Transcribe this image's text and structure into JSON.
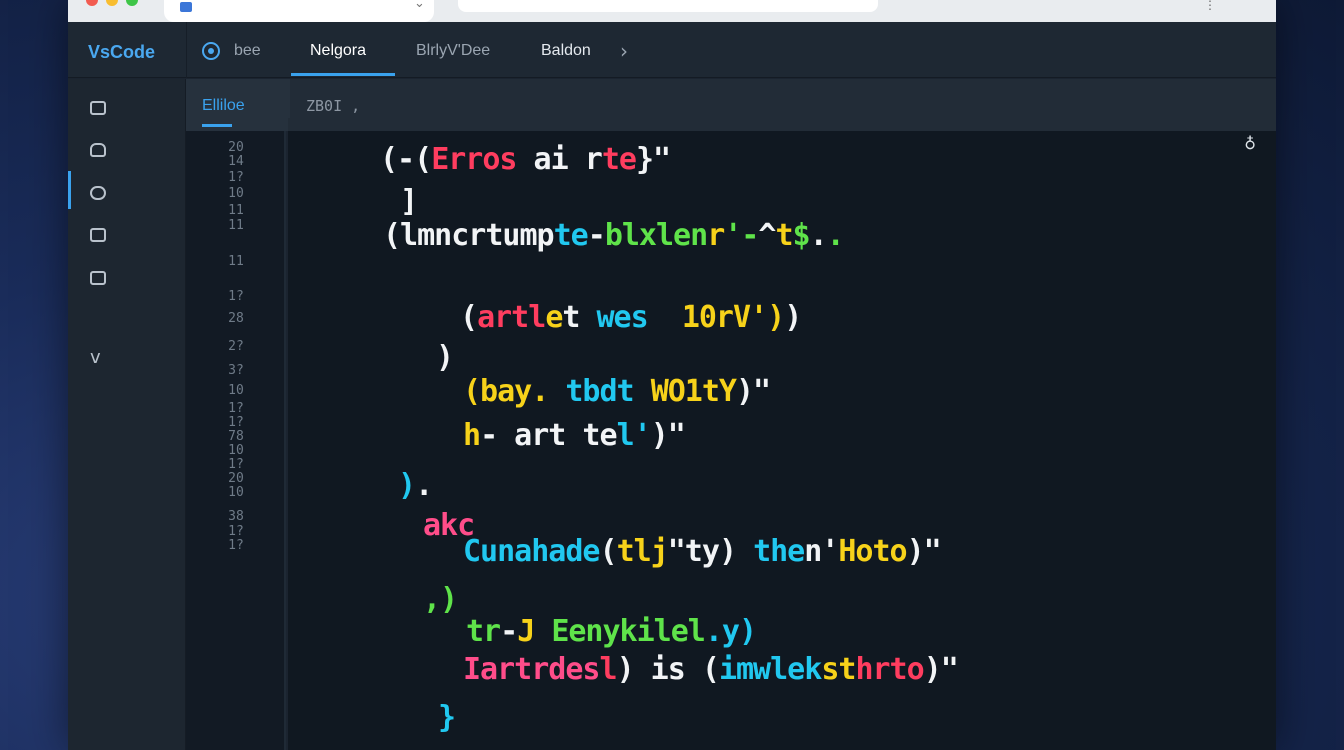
{
  "app": {
    "brand": "VsCode",
    "nav": [
      "bee",
      "Nelgora",
      "BlrlyV'Dee",
      "Baldon"
    ],
    "active_nav": 1
  },
  "editor_tabs": [
    "Elliloe",
    "ZB0I ,"
  ],
  "line_numbers": [
    "20",
    "14",
    "1?",
    "10",
    "11",
    "11",
    "11",
    "1?",
    "28",
    "2?",
    "3?",
    "10",
    "1?",
    "1?",
    "78",
    "10",
    "1?",
    "20",
    "10",
    "38",
    "1?",
    "1?"
  ],
  "code_lines": [
    [
      {
        "t": "(-(",
        "c": "w"
      },
      {
        "t": "Erros",
        "c": "r"
      },
      {
        "t": " ai ",
        "c": "w"
      },
      {
        "t": "r",
        "c": "w"
      },
      {
        "t": "te",
        "c": "r"
      },
      {
        "t": "}\"",
        "c": "w"
      }
    ],
    [
      {
        "t": "]",
        "c": "w"
      }
    ],
    [
      {
        "t": "(lmncrtump",
        "c": "w"
      },
      {
        "t": "te",
        "c": "c"
      },
      {
        "t": "-",
        "c": "w"
      },
      {
        "t": "blxlen",
        "c": "g"
      },
      {
        "t": "r",
        "c": "y"
      },
      {
        "t": "'-",
        "c": "g"
      },
      {
        "t": "^",
        "c": "w"
      },
      {
        "t": "t",
        "c": "y"
      },
      {
        "t": "$",
        "c": "g"
      },
      {
        "t": ".",
        "c": "w"
      },
      {
        "t": ".",
        "c": "g"
      }
    ],
    [
      {
        "t": "(",
        "c": "w"
      },
      {
        "t": "artl",
        "c": "r"
      },
      {
        "t": "e",
        "c": "y"
      },
      {
        "t": "t ",
        "c": "w"
      },
      {
        "t": "wes",
        "c": "c"
      },
      {
        "t": "  ",
        "c": "w"
      },
      {
        "t": "10rV')",
        "c": "y"
      },
      {
        "t": ")",
        "c": "w"
      }
    ],
    [
      {
        "t": ")",
        "c": "w"
      }
    ],
    [
      {
        "t": "(bay.",
        "c": "y"
      },
      {
        "t": " tbdt",
        "c": "c"
      },
      {
        "t": " ",
        "c": "w"
      },
      {
        "t": "WO1tY",
        "c": "y"
      },
      {
        "t": ")\"",
        "c": "w"
      }
    ],
    [
      {
        "t": "h",
        "c": "y"
      },
      {
        "t": "- art te",
        "c": "w"
      },
      {
        "t": "l'",
        "c": "c"
      },
      {
        "t": ")\"",
        "c": "w"
      }
    ],
    [
      {
        "t": ")",
        "c": "c"
      },
      {
        "t": ".",
        "c": "w"
      }
    ],
    [
      {
        "t": "akc",
        "c": "p"
      }
    ],
    [
      {
        "t": "Cunahade",
        "c": "c"
      },
      {
        "t": "(",
        "c": "w"
      },
      {
        "t": "tlj",
        "c": "y"
      },
      {
        "t": "\"ty",
        "c": "w"
      },
      {
        "t": ") ",
        "c": "w"
      },
      {
        "t": "the",
        "c": "c"
      },
      {
        "t": "n'",
        "c": "w"
      },
      {
        "t": "Hoto",
        "c": "y"
      },
      {
        "t": ")\"",
        "c": "w"
      }
    ],
    [
      {
        "t": ",)",
        "c": "g"
      }
    ],
    [
      {
        "t": "tr",
        "c": "g"
      },
      {
        "t": "-",
        "c": "w"
      },
      {
        "t": "J ",
        "c": "y"
      },
      {
        "t": "Eenykilel",
        "c": "g"
      },
      {
        "t": ".y)",
        "c": "c"
      }
    ],
    [
      {
        "t": "Iartrdes",
        "c": "p"
      },
      {
        "t": "l",
        "c": "r"
      },
      {
        "t": ") is (",
        "c": "w"
      },
      {
        "t": "imwlek",
        "c": "c"
      },
      {
        "t": "st",
        "c": "y"
      },
      {
        "t": "hrto",
        "c": "r"
      },
      {
        "t": ")\"",
        "c": "w"
      }
    ],
    [
      {
        "t": "}",
        "c": "c"
      }
    ]
  ],
  "icons": {
    "activity": [
      "explorer-icon",
      "package-icon",
      "search-icon",
      "list-icon",
      "window-icon",
      "chevron-down-icon"
    ],
    "panel": "person-icon",
    "nav_chevron": "chevron-right-icon",
    "nav_logo": "target-icon"
  },
  "colors": {
    "accent": "#3aa2ee",
    "background": "#101821",
    "sidebar": "#1d2630"
  }
}
